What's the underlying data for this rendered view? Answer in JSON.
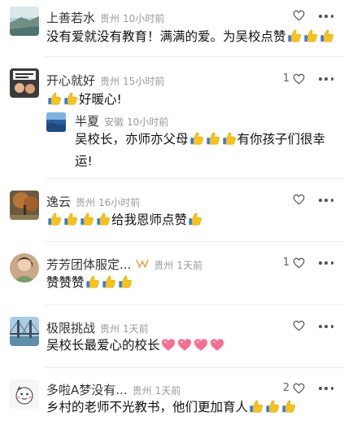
{
  "colors": {
    "accent": "#f4b400",
    "heart_pink": "#f06a8a",
    "meta_gray": "#9a9a9a"
  },
  "comments": [
    {
      "username": "上善若水",
      "location": "贵州",
      "time": "10小时前",
      "likes": "",
      "text": "没有爱就没有教育！满满的爱。为吴校点赞",
      "avatar_icon": "lake-landscape-avatar",
      "reply": null
    },
    {
      "username": "开心就好",
      "location": "贵州",
      "time": "15小时前",
      "likes": "1",
      "text": "好暖心!",
      "avatar_icon": "please-sign-avatar",
      "reply": {
        "username": "半夏",
        "location": "安徽",
        "time": "10小时前",
        "text_line1": "吴校长，亦师亦父母",
        "text_line1_suffix": "有你孩子们很幸",
        "text_line2": "运!",
        "avatar_icon": "ocean-avatar"
      }
    },
    {
      "username": "逸云",
      "location": "贵州",
      "time": "16小时前",
      "likes": "",
      "text": "给我恩师点赞",
      "avatar_icon": "autumn-tree-avatar",
      "reply": null
    },
    {
      "username": "芳芳团体服定...",
      "location": "贵州",
      "time": "1天前",
      "likes": "1",
      "text": "赞赞赞",
      "avatar_icon": "portrait-avatar",
      "reply": null
    },
    {
      "username": "极限挑战",
      "location": "贵州",
      "time": "1天前",
      "likes": "",
      "text": "吴校长最爱心的校长",
      "avatar_icon": "bridge-avatar",
      "reply": null
    },
    {
      "username": "多啦A梦没有...",
      "location": "贵州",
      "time": "1天前",
      "likes": "2",
      "text": "乡村的老师不光教书，他们更加育人",
      "avatar_icon": "cartoon-avatar",
      "reply": null
    }
  ]
}
